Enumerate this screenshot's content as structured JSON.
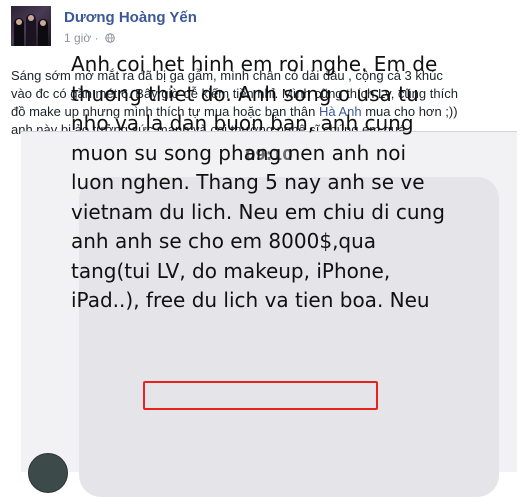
{
  "post": {
    "author": "Dương Hoàng Yến",
    "time": "1 giờ",
    "audience_icon": "globe-icon",
    "lines": [
      "Sáng sớm mở mắt ra đã bị ga gẫm, mình chân có dài đâu , cộng cả 3 khúc",
      "vào đc có gần mét 6. Bây giờ dễ kiếm tiền nhỉ. Mình cũng thích Lv, cũng thích",
      "đồ make up nhưng mình thích tự mua hoặc bạn thân",
      "anh này bị ảo tưởng sức mạnh và coi thường nghệ sĩ chúng em quá !"
    ],
    "tag": "Hà Anh",
    "line3_end": " mua cho hơn ;))"
  },
  "sms": {
    "time": "09:10",
    "lines": [
      "Anh coi het hinh em roi nghe. Em de",
      "thuong thiet do. Anh song o usa tu",
      "nho va la dan buon ban, anh cung",
      "muon su song phang nen anh noi",
      "luon nghen. Thang 5 nay anh se ve",
      "vietnam du lich. Neu em chiu di cung"
    ],
    "line7_start": "anh",
    "highlighted": "anh se cho em 8000$",
    "line7_end": ",qua",
    "line8": "tang(tui LV, do makeup, iPhone,",
    "line9": "iPad..), free du lich va tien boa. Neu"
  },
  "colors": {
    "author_name": "#3b5998",
    "highlight_border": "#e8231f",
    "bubble": "#e4e4e9"
  }
}
